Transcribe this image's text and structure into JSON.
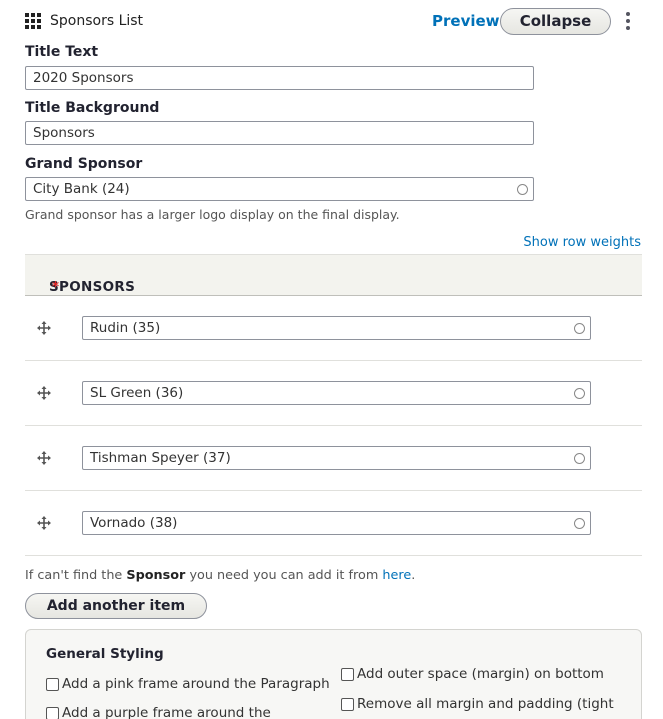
{
  "header": {
    "title": "Sponsors List",
    "preview_label": "Preview",
    "collapse_label": "Collapse"
  },
  "fields": {
    "title_text": {
      "label": "Title Text",
      "value": "2020 Sponsors"
    },
    "title_background": {
      "label": "Title Background",
      "value": "Sponsors"
    },
    "grand_sponsor": {
      "label": "Grand Sponsor",
      "value": "City Bank (24)",
      "description": "Grand sponsor has a larger logo display on the final display."
    }
  },
  "sponsors": {
    "show_row_weights": "Show row weights",
    "heading": "SPONSORS",
    "required_marker": "*",
    "rows": [
      {
        "value": "Rudin (35)"
      },
      {
        "value": "SL Green (36)"
      },
      {
        "value": "Tishman Speyer (37)"
      },
      {
        "value": "Vornado (38)"
      }
    ],
    "help_prefix": "If can't find the ",
    "help_bold": "Sponsor",
    "help_middle": " you need you can add it from ",
    "help_link": "here",
    "help_suffix": ".",
    "add_label": "Add another item"
  },
  "styling": {
    "title": "General Styling",
    "options": {
      "pink_frame": "Add a pink frame around the Paragraph",
      "purple_frame": "Add a purple frame around the",
      "outer_space": "Add outer space (margin) on bottom",
      "remove_margin": "Remove all margin and padding (tight"
    }
  },
  "icons": {
    "bundle": "grid-icon",
    "menu": "kebab-menu-icon",
    "drag": "drag-handle-icon",
    "autocomplete": "autocomplete-throbber-icon"
  }
}
